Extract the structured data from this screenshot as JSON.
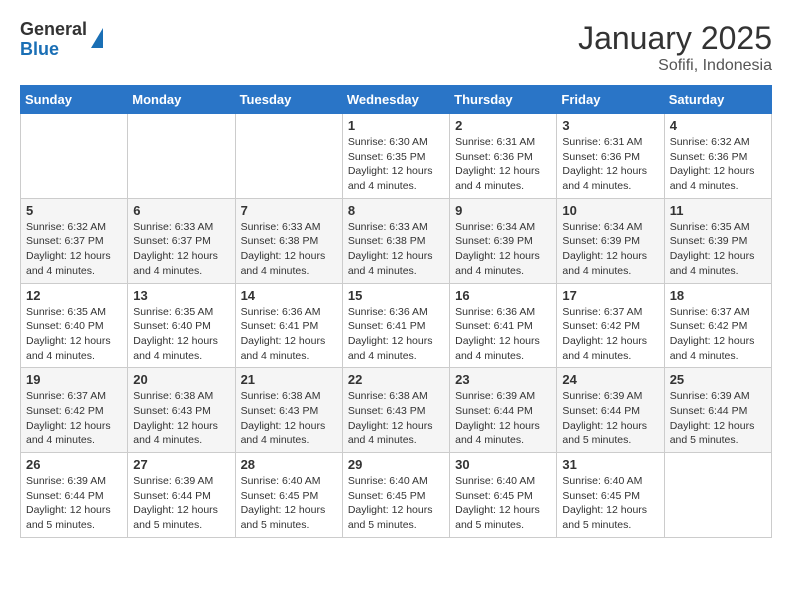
{
  "header": {
    "logo_general": "General",
    "logo_blue": "Blue",
    "title": "January 2025",
    "subtitle": "Sofifi, Indonesia"
  },
  "days_of_week": [
    "Sunday",
    "Monday",
    "Tuesday",
    "Wednesday",
    "Thursday",
    "Friday",
    "Saturday"
  ],
  "weeks": [
    [
      {
        "day": "",
        "text": ""
      },
      {
        "day": "",
        "text": ""
      },
      {
        "day": "",
        "text": ""
      },
      {
        "day": "1",
        "text": "Sunrise: 6:30 AM\nSunset: 6:35 PM\nDaylight: 12 hours and 4 minutes."
      },
      {
        "day": "2",
        "text": "Sunrise: 6:31 AM\nSunset: 6:36 PM\nDaylight: 12 hours and 4 minutes."
      },
      {
        "day": "3",
        "text": "Sunrise: 6:31 AM\nSunset: 6:36 PM\nDaylight: 12 hours and 4 minutes."
      },
      {
        "day": "4",
        "text": "Sunrise: 6:32 AM\nSunset: 6:36 PM\nDaylight: 12 hours and 4 minutes."
      }
    ],
    [
      {
        "day": "5",
        "text": "Sunrise: 6:32 AM\nSunset: 6:37 PM\nDaylight: 12 hours and 4 minutes."
      },
      {
        "day": "6",
        "text": "Sunrise: 6:33 AM\nSunset: 6:37 PM\nDaylight: 12 hours and 4 minutes."
      },
      {
        "day": "7",
        "text": "Sunrise: 6:33 AM\nSunset: 6:38 PM\nDaylight: 12 hours and 4 minutes."
      },
      {
        "day": "8",
        "text": "Sunrise: 6:33 AM\nSunset: 6:38 PM\nDaylight: 12 hours and 4 minutes."
      },
      {
        "day": "9",
        "text": "Sunrise: 6:34 AM\nSunset: 6:39 PM\nDaylight: 12 hours and 4 minutes."
      },
      {
        "day": "10",
        "text": "Sunrise: 6:34 AM\nSunset: 6:39 PM\nDaylight: 12 hours and 4 minutes."
      },
      {
        "day": "11",
        "text": "Sunrise: 6:35 AM\nSunset: 6:39 PM\nDaylight: 12 hours and 4 minutes."
      }
    ],
    [
      {
        "day": "12",
        "text": "Sunrise: 6:35 AM\nSunset: 6:40 PM\nDaylight: 12 hours and 4 minutes."
      },
      {
        "day": "13",
        "text": "Sunrise: 6:35 AM\nSunset: 6:40 PM\nDaylight: 12 hours and 4 minutes."
      },
      {
        "day": "14",
        "text": "Sunrise: 6:36 AM\nSunset: 6:41 PM\nDaylight: 12 hours and 4 minutes."
      },
      {
        "day": "15",
        "text": "Sunrise: 6:36 AM\nSunset: 6:41 PM\nDaylight: 12 hours and 4 minutes."
      },
      {
        "day": "16",
        "text": "Sunrise: 6:36 AM\nSunset: 6:41 PM\nDaylight: 12 hours and 4 minutes."
      },
      {
        "day": "17",
        "text": "Sunrise: 6:37 AM\nSunset: 6:42 PM\nDaylight: 12 hours and 4 minutes."
      },
      {
        "day": "18",
        "text": "Sunrise: 6:37 AM\nSunset: 6:42 PM\nDaylight: 12 hours and 4 minutes."
      }
    ],
    [
      {
        "day": "19",
        "text": "Sunrise: 6:37 AM\nSunset: 6:42 PM\nDaylight: 12 hours and 4 minutes."
      },
      {
        "day": "20",
        "text": "Sunrise: 6:38 AM\nSunset: 6:43 PM\nDaylight: 12 hours and 4 minutes."
      },
      {
        "day": "21",
        "text": "Sunrise: 6:38 AM\nSunset: 6:43 PM\nDaylight: 12 hours and 4 minutes."
      },
      {
        "day": "22",
        "text": "Sunrise: 6:38 AM\nSunset: 6:43 PM\nDaylight: 12 hours and 4 minutes."
      },
      {
        "day": "23",
        "text": "Sunrise: 6:39 AM\nSunset: 6:44 PM\nDaylight: 12 hours and 4 minutes."
      },
      {
        "day": "24",
        "text": "Sunrise: 6:39 AM\nSunset: 6:44 PM\nDaylight: 12 hours and 5 minutes."
      },
      {
        "day": "25",
        "text": "Sunrise: 6:39 AM\nSunset: 6:44 PM\nDaylight: 12 hours and 5 minutes."
      }
    ],
    [
      {
        "day": "26",
        "text": "Sunrise: 6:39 AM\nSunset: 6:44 PM\nDaylight: 12 hours and 5 minutes."
      },
      {
        "day": "27",
        "text": "Sunrise: 6:39 AM\nSunset: 6:44 PM\nDaylight: 12 hours and 5 minutes."
      },
      {
        "day": "28",
        "text": "Sunrise: 6:40 AM\nSunset: 6:45 PM\nDaylight: 12 hours and 5 minutes."
      },
      {
        "day": "29",
        "text": "Sunrise: 6:40 AM\nSunset: 6:45 PM\nDaylight: 12 hours and 5 minutes."
      },
      {
        "day": "30",
        "text": "Sunrise: 6:40 AM\nSunset: 6:45 PM\nDaylight: 12 hours and 5 minutes."
      },
      {
        "day": "31",
        "text": "Sunrise: 6:40 AM\nSunset: 6:45 PM\nDaylight: 12 hours and 5 minutes."
      },
      {
        "day": "",
        "text": ""
      }
    ]
  ]
}
